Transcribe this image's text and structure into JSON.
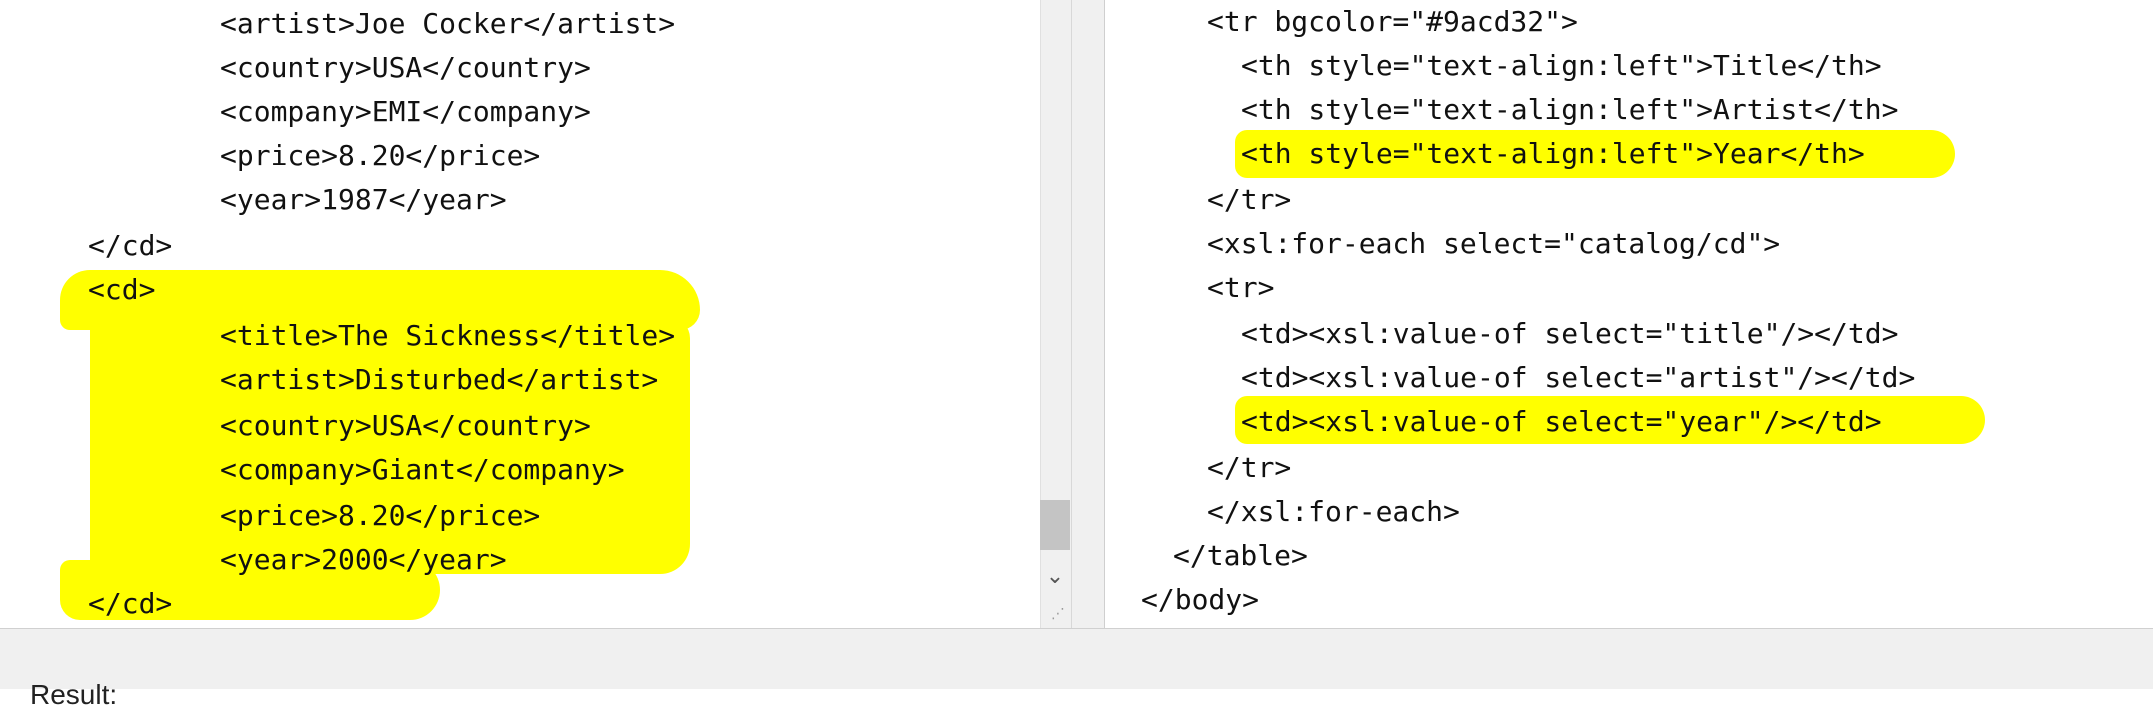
{
  "left_editor": {
    "lines": [
      "<artist>Joe Cocker</artist>",
      "<country>USA</country>",
      "<company>EMI</company>",
      "<price>8.20</price>",
      "<year>1987</year>",
      "</cd>",
      "<cd>",
      "<title>The Sickness</title>",
      "<artist>Disturbed</artist>",
      "<country>USA</country>",
      "<company>Giant</company>",
      "<price>8.20</price>",
      "<year>2000</year>",
      "</cd>"
    ]
  },
  "right_editor": {
    "lines": [
      "<tr bgcolor=\"#9acd32\">",
      "<th style=\"text-align:left\">Title</th>",
      "<th style=\"text-align:left\">Artist</th>",
      "<th style=\"text-align:left\">Year</th>",
      "</tr>",
      "<xsl:for-each select=\"catalog/cd\">",
      "<tr>",
      "<td><xsl:value-of select=\"title\"/></td>",
      "<td><xsl:value-of select=\"artist\"/></td>",
      "<td><xsl:value-of select=\"year\"/></td>",
      "</tr>",
      "</xsl:for-each>",
      "</table>",
      "</body>"
    ]
  },
  "bottom_label": "Result:",
  "colors": {
    "highlight": "#ffff00",
    "squiggle": "#d00000",
    "panel": "#f0f0f0"
  },
  "icons": {
    "scroll_down": "chevron-down-icon",
    "resize": "resize-grip-icon"
  }
}
